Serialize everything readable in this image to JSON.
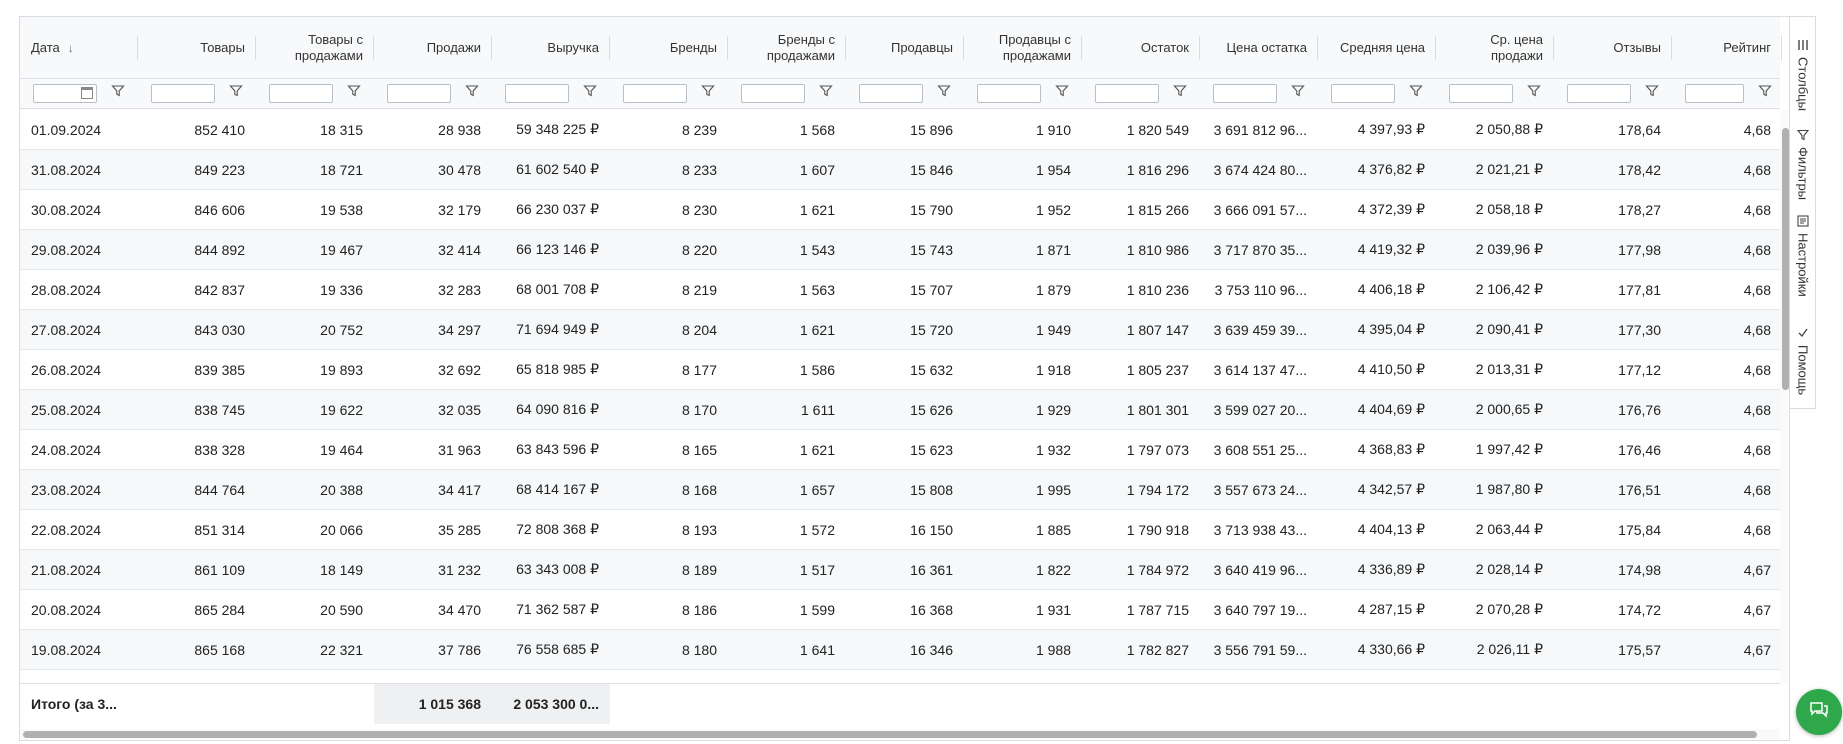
{
  "columns": [
    {
      "label": "Дата",
      "sort": "↓"
    },
    {
      "label": "Товары"
    },
    {
      "label": "Товары с продажами"
    },
    {
      "label": "Продажи"
    },
    {
      "label": "Выручка"
    },
    {
      "label": "Бренды"
    },
    {
      "label": "Бренды с продажами"
    },
    {
      "label": "Продавцы"
    },
    {
      "label": "Продавцы с продажами"
    },
    {
      "label": "Остаток"
    },
    {
      "label": "Цена остатка"
    },
    {
      "label": "Средняя цена"
    },
    {
      "label": "Ср. цена продажи"
    },
    {
      "label": "Отзывы"
    },
    {
      "label": "Рейтинг"
    }
  ],
  "rows": [
    [
      "01.09.2024",
      "852 410",
      "18 315",
      "28 938",
      "59 348 225 ₽",
      "8 239",
      "1 568",
      "15 896",
      "1 910",
      "1 820 549",
      "3 691 812 96...",
      "4 397,93 ₽",
      "2 050,88 ₽",
      "178,64",
      "4,68"
    ],
    [
      "31.08.2024",
      "849 223",
      "18 721",
      "30 478",
      "61 602 540 ₽",
      "8 233",
      "1 607",
      "15 846",
      "1 954",
      "1 816 296",
      "3 674 424 80...",
      "4 376,82 ₽",
      "2 021,21 ₽",
      "178,42",
      "4,68"
    ],
    [
      "30.08.2024",
      "846 606",
      "19 538",
      "32 179",
      "66 230 037 ₽",
      "8 230",
      "1 621",
      "15 790",
      "1 952",
      "1 815 266",
      "3 666 091 57...",
      "4 372,39 ₽",
      "2 058,18 ₽",
      "178,27",
      "4,68"
    ],
    [
      "29.08.2024",
      "844 892",
      "19 467",
      "32 414",
      "66 123 146 ₽",
      "8 220",
      "1 543",
      "15 743",
      "1 871",
      "1 810 986",
      "3 717 870 35...",
      "4 419,32 ₽",
      "2 039,96 ₽",
      "177,98",
      "4,68"
    ],
    [
      "28.08.2024",
      "842 837",
      "19 336",
      "32 283",
      "68 001 708 ₽",
      "8 219",
      "1 563",
      "15 707",
      "1 879",
      "1 810 236",
      "3 753 110 96...",
      "4 406,18 ₽",
      "2 106,42 ₽",
      "177,81",
      "4,68"
    ],
    [
      "27.08.2024",
      "843 030",
      "20 752",
      "34 297",
      "71 694 949 ₽",
      "8 204",
      "1 621",
      "15 720",
      "1 949",
      "1 807 147",
      "3 639 459 39...",
      "4 395,04 ₽",
      "2 090,41 ₽",
      "177,30",
      "4,68"
    ],
    [
      "26.08.2024",
      "839 385",
      "19 893",
      "32 692",
      "65 818 985 ₽",
      "8 177",
      "1 586",
      "15 632",
      "1 918",
      "1 805 237",
      "3 614 137 47...",
      "4 410,50 ₽",
      "2 013,31 ₽",
      "177,12",
      "4,68"
    ],
    [
      "25.08.2024",
      "838 745",
      "19 622",
      "32 035",
      "64 090 816 ₽",
      "8 170",
      "1 611",
      "15 626",
      "1 929",
      "1 801 301",
      "3 599 027 20...",
      "4 404,69 ₽",
      "2 000,65 ₽",
      "176,76",
      "4,68"
    ],
    [
      "24.08.2024",
      "838 328",
      "19 464",
      "31 963",
      "63 843 596 ₽",
      "8 165",
      "1 621",
      "15 623",
      "1 932",
      "1 797 073",
      "3 608 551 25...",
      "4 368,83 ₽",
      "1 997,42 ₽",
      "176,46",
      "4,68"
    ],
    [
      "23.08.2024",
      "844 764",
      "20 388",
      "34 417",
      "68 414 167 ₽",
      "8 168",
      "1 657",
      "15 808",
      "1 995",
      "1 794 172",
      "3 557 673 24...",
      "4 342,57 ₽",
      "1 987,80 ₽",
      "176,51",
      "4,68"
    ],
    [
      "22.08.2024",
      "851 314",
      "20 066",
      "35 285",
      "72 808 368 ₽",
      "8 193",
      "1 572",
      "16 150",
      "1 885",
      "1 790 918",
      "3 713 938 43...",
      "4 404,13 ₽",
      "2 063,44 ₽",
      "175,84",
      "4,68"
    ],
    [
      "21.08.2024",
      "861 109",
      "18 149",
      "31 232",
      "63 343 008 ₽",
      "8 189",
      "1 517",
      "16 361",
      "1 822",
      "1 784 972",
      "3 640 419 96...",
      "4 336,89 ₽",
      "2 028,14 ₽",
      "174,98",
      "4,67"
    ],
    [
      "20.08.2024",
      "865 284",
      "20 590",
      "34 470",
      "71 362 587 ₽",
      "8 186",
      "1 599",
      "16 368",
      "1 931",
      "1 787 715",
      "3 640 797 19...",
      "4 287,15 ₽",
      "2 070,28 ₽",
      "174,72",
      "4,67"
    ],
    [
      "19.08.2024",
      "865 168",
      "22 321",
      "37 786",
      "76 558 685 ₽",
      "8 180",
      "1 641",
      "16 346",
      "1 988",
      "1 782 827",
      "3 556 791 59...",
      "4 330,66 ₽",
      "2 026,11 ₽",
      "175,57",
      "4,67"
    ]
  ],
  "footer": {
    "label": "Итого (за 3...",
    "sales_total": "1 015 368",
    "revenue_total": "2 053 300 0..."
  },
  "sidebar": {
    "columns_label": "Столбцы",
    "filters_label": "Фильтры",
    "settings_label": "Настройки",
    "help_label": "Помощь"
  },
  "icons": {
    "filter": "funnel-icon",
    "calendar": "calendar-icon",
    "columns": "columns-icon",
    "settings": "settings-icon",
    "help": "help-check-icon",
    "chat": "chat-icon"
  },
  "colors": {
    "accent_green": "#2ea84a",
    "header_bg": "#f8f9fa",
    "alt_row_bg": "#f6f8fa",
    "footer_highlight": "#eef0f2"
  }
}
